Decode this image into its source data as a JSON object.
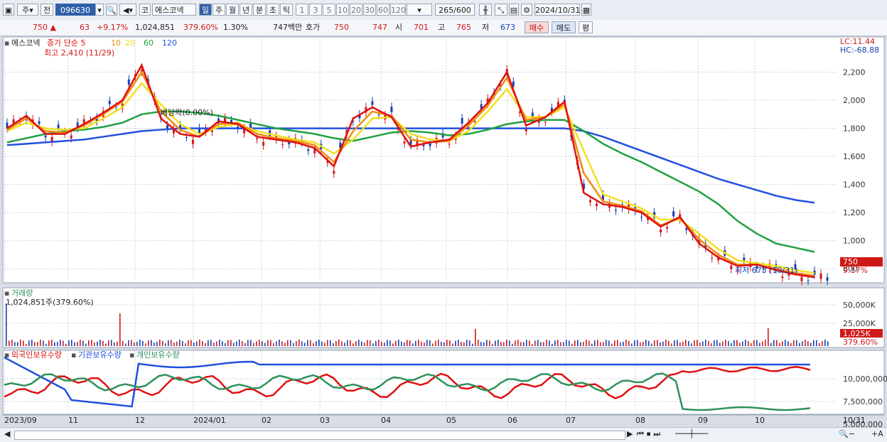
{
  "toolbar": {
    "period_label": "주",
    "prev_label": "전",
    "code": "096630",
    "exchange": "코",
    "stock_name": "에스코넥",
    "periods": [
      "일",
      "주",
      "월",
      "년",
      "분",
      "초",
      "틱"
    ],
    "selected_period": "일",
    "intervals": [
      "1",
      "3",
      "5",
      "10",
      "20",
      "30",
      "60",
      "120"
    ],
    "count": "265",
    "count_total": "/600",
    "date": "2024/10/31"
  },
  "info": {
    "price": "750",
    "change": "63",
    "change_pct": "+9.17%",
    "volume": "1,024,851",
    "vol_ratio": "379.60%",
    "turnover_pct": "1.30%",
    "amount": "747백만",
    "bid_label": "호가",
    "bid1": "750",
    "bid2": "747",
    "open_label": "시",
    "open": "701",
    "high_label": "고",
    "high": "765",
    "low_label": "저",
    "low": "673",
    "buy_label": "매수",
    "sell_label": "매도",
    "avg_label": "평"
  },
  "price_panel": {
    "legend_name": "에스코넥",
    "legend_ma": "종가 단순 5",
    "ma_periods": [
      "10",
      "20",
      "60",
      "120"
    ],
    "high_note": "최고 2,410 (11/29)",
    "low_note": "최저 673 (10/31)",
    "dividend_note": "배당락(0.00%)",
    "lc": "LC:11.44",
    "hc": "HC:-68.88",
    "y_ticks": [
      "2,200",
      "2,000",
      "1,800",
      "1,600",
      "1,400",
      "1,200",
      "1,000",
      "800"
    ],
    "current_price_tag": "750",
    "current_pct_tag": "9.17%"
  },
  "volume_panel": {
    "title": "거래량",
    "value_note": "1,024,851주(379.60%)",
    "y_ticks": [
      "50,000K",
      "25,000K"
    ],
    "current_tag": "1,025K",
    "current_pct": "379.60%"
  },
  "holding_panel": {
    "legends": [
      "외국인보유수량",
      "기관보유수량",
      "개인보유수량"
    ],
    "y_ticks": [
      "10,000,000",
      "7,500,000",
      "5,000,000"
    ]
  },
  "x_axis": {
    "labels": [
      "2023/09",
      "11",
      "12",
      "2024/01",
      "02",
      "03",
      "04",
      "05",
      "06",
      "07",
      "08",
      "09",
      "10"
    ],
    "right_label": "10/31"
  },
  "colors": {
    "up": "#d01818",
    "down": "#1a3fb0",
    "ma5": "#e01010",
    "ma10": "#f08c10",
    "ma20": "#f0e020",
    "ma60": "#20a040",
    "ma120": "#2050e0",
    "foreign": "#e01010",
    "inst": "#2050e0",
    "indiv": "#30905a"
  },
  "chart_data": {
    "type": "line",
    "title": "에스코넥",
    "series": [
      {
        "name": "종가 단순 5",
        "values": [
          1800,
          1890,
          1760,
          1760,
          1830,
          1910,
          2000,
          2250,
          1870,
          1760,
          1740,
          1850,
          1830,
          1740,
          1720,
          1700,
          1660,
          1530,
          1870,
          1950,
          1880,
          1670,
          1700,
          1720,
          1840,
          1980,
          2200,
          1820,
          1880,
          1990,
          1340,
          1260,
          1240,
          1200,
          1100,
          1170,
          980,
          880,
          820,
          830,
          790,
          760,
          740
        ]
      },
      {
        "name": "10",
        "values": [
          1790,
          1870,
          1780,
          1770,
          1820,
          1900,
          1990,
          2200,
          1920,
          1790,
          1740,
          1830,
          1840,
          1760,
          1730,
          1710,
          1680,
          1560,
          1780,
          1920,
          1890,
          1720,
          1700,
          1710,
          1820,
          1960,
          2160,
          1860,
          1880,
          1970,
          1480,
          1280,
          1250,
          1210,
          1110,
          1160,
          1010,
          900,
          830,
          830,
          800,
          770,
          750
        ]
      },
      {
        "name": "20",
        "values": [
          1780,
          1840,
          1800,
          1790,
          1800,
          1870,
          1950,
          2120,
          1970,
          1830,
          1760,
          1810,
          1830,
          1780,
          1750,
          1720,
          1700,
          1620,
          1720,
          1870,
          1880,
          1760,
          1720,
          1710,
          1780,
          1920,
          2080,
          1880,
          1880,
          1950,
          1640,
          1330,
          1280,
          1230,
          1150,
          1150,
          1050,
          940,
          860,
          840,
          820,
          790,
          770
        ]
      },
      {
        "name": "60",
        "values": [
          1700,
          1730,
          1760,
          1780,
          1790,
          1810,
          1840,
          1900,
          1920,
          1920,
          1910,
          1890,
          1860,
          1830,
          1800,
          1780,
          1760,
          1730,
          1710,
          1740,
          1770,
          1780,
          1770,
          1750,
          1760,
          1790,
          1830,
          1850,
          1860,
          1860,
          1780,
          1690,
          1620,
          1560,
          1490,
          1420,
          1350,
          1260,
          1140,
          1050,
          980,
          950,
          920
        ]
      },
      {
        "name": "120",
        "values": [
          1680,
          1690,
          1700,
          1710,
          1720,
          1740,
          1760,
          1780,
          1790,
          1800,
          1800,
          1800,
          1800,
          1800,
          1800,
          1800,
          1800,
          1800,
          1800,
          1800,
          1800,
          1800,
          1800,
          1800,
          1800,
          1800,
          1800,
          1800,
          1800,
          1800,
          1780,
          1740,
          1690,
          1640,
          1590,
          1540,
          1490,
          1440,
          1400,
          1360,
          1320,
          1290,
          1270
        ]
      }
    ],
    "ylim": [
      700,
      2400
    ]
  }
}
